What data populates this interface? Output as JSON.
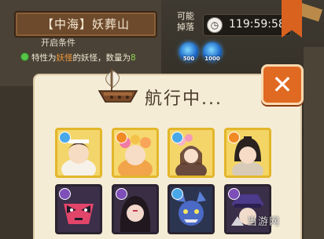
{
  "header": {
    "title": "【中海】妖葬山",
    "open_condition_label": "开启条件",
    "condition": {
      "prefix": "特性为",
      "highlight": "妖怪",
      "middle": "的妖怪，数量为",
      "count": "8"
    }
  },
  "drops": {
    "label": "可能掉落",
    "timer": "119:59:58",
    "items": [
      {
        "icon": "blue-soul-orb-icon",
        "amount": "500"
      },
      {
        "icon": "blue-soul-orb-icon",
        "amount": "1000"
      }
    ]
  },
  "dialog": {
    "status_text": "航行中...",
    "close_icon": "close-x-icon",
    "heroes_row1": [
      {
        "icon": "hero-portrait-white-robe",
        "element": "water",
        "frame": "gold"
      },
      {
        "icon": "hero-portrait-flower-crown",
        "element": "fire",
        "frame": "gold"
      },
      {
        "icon": "hero-portrait-pink-flowers",
        "element": "water",
        "frame": "gold"
      },
      {
        "icon": "hero-portrait-black-hair",
        "element": "fire",
        "frame": "gold"
      }
    ],
    "heroes_row2": [
      {
        "icon": "hero-portrait-red-mask",
        "element": "dark",
        "frame": "purple"
      },
      {
        "icon": "hero-portrait-long-hair",
        "element": "dark",
        "frame": "purple"
      },
      {
        "icon": "hero-portrait-blue-demon",
        "element": "water",
        "frame": "purple"
      },
      {
        "icon": "hero-portrait-purple-hat",
        "element": "dark",
        "frame": "purple"
      }
    ]
  },
  "watermark": {
    "text": "当游网"
  },
  "colors": {
    "accent_orange": "#e06a22",
    "dialog_bg": "#f5ecd6",
    "highlight_text": "#f39a3a",
    "count_text": "#8fd84f"
  }
}
